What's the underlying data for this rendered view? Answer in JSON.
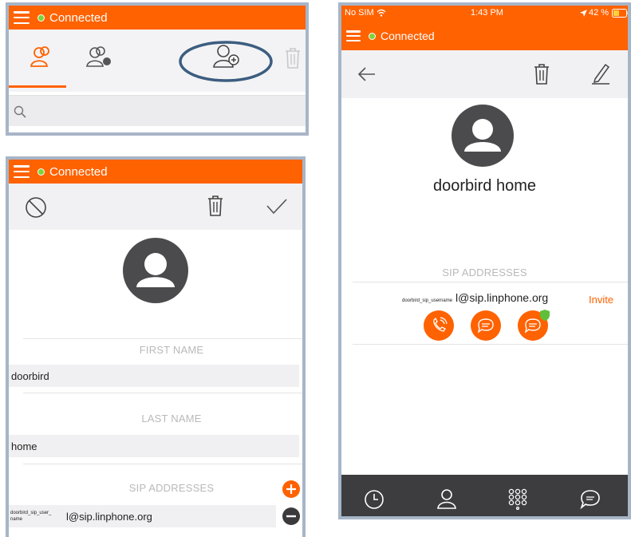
{
  "status": {
    "connected_label": "Connected"
  },
  "ios_status": {
    "carrier": "No SIM",
    "time": "1:43 PM",
    "battery": "42 %"
  },
  "list_view": {
    "search_placeholder": ""
  },
  "edit_view": {
    "first_name_label": "FIRST NAME",
    "first_name_value": "doorbird",
    "last_name_label": "LAST NAME",
    "last_name_value": "home",
    "sip_label": "SIP ADDRESSES",
    "sip_user_hint_line1": "doorbird_sip_user_",
    "sip_user_hint_line2": "name",
    "sip_domain": "l@sip.linphone.org"
  },
  "detail_view": {
    "contact_name": "doorbird home",
    "sip_label": "SIP ADDRESSES",
    "sip_user_hint": "doorbird_sip_username",
    "sip_domain": "l@sip.linphone.org",
    "invite_label": "Invite"
  },
  "colors": {
    "accent": "#ff6200",
    "presence": "#7cd33a",
    "toolbar": "#f1f1f3",
    "tabbar": "#3d3d3f"
  }
}
